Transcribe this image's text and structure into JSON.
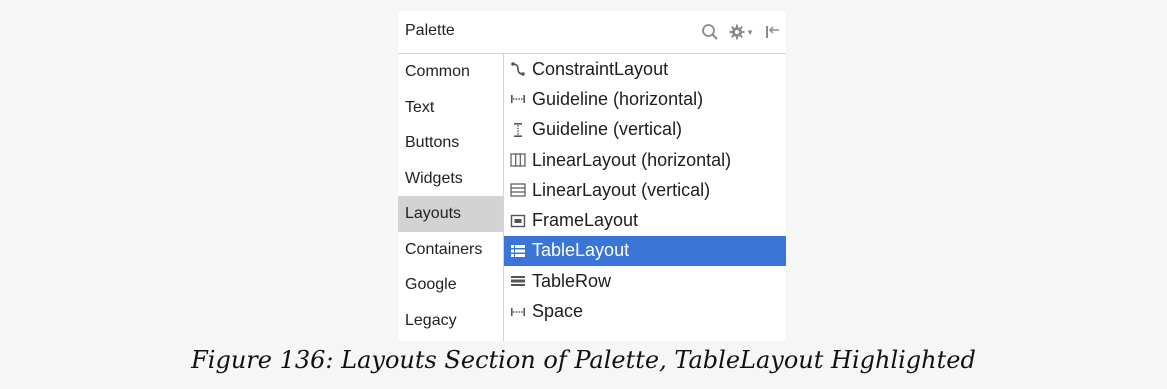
{
  "palette": {
    "title": "Palette",
    "toolbar": {
      "search_icon": "search-icon",
      "settings_icon": "gear-icon",
      "hide_icon": "pin-left-icon"
    },
    "categories": [
      {
        "label": "Common"
      },
      {
        "label": "Text"
      },
      {
        "label": "Buttons"
      },
      {
        "label": "Widgets"
      },
      {
        "label": "Layouts",
        "selected": true
      },
      {
        "label": "Containers"
      },
      {
        "label": "Google"
      },
      {
        "label": "Legacy"
      }
    ],
    "items": [
      {
        "label": "ConstraintLayout",
        "icon": "constraint-layout-icon"
      },
      {
        "label": "Guideline (horizontal)",
        "icon": "guideline-horizontal-icon"
      },
      {
        "label": "Guideline (vertical)",
        "icon": "guideline-vertical-icon"
      },
      {
        "label": "LinearLayout (horizontal)",
        "icon": "linear-layout-horizontal-icon"
      },
      {
        "label": "LinearLayout (vertical)",
        "icon": "linear-layout-vertical-icon"
      },
      {
        "label": "FrameLayout",
        "icon": "frame-layout-icon"
      },
      {
        "label": "TableLayout",
        "icon": "table-layout-icon",
        "selected": true
      },
      {
        "label": "TableRow",
        "icon": "table-row-icon"
      },
      {
        "label": "Space",
        "icon": "space-icon"
      }
    ]
  },
  "colors": {
    "selection": "#3c75d8",
    "category_selection": "#d3d3d3",
    "background": "#f6f6f6"
  },
  "caption": "Figure 136: Layouts Section of Palette, TableLayout Highlighted"
}
